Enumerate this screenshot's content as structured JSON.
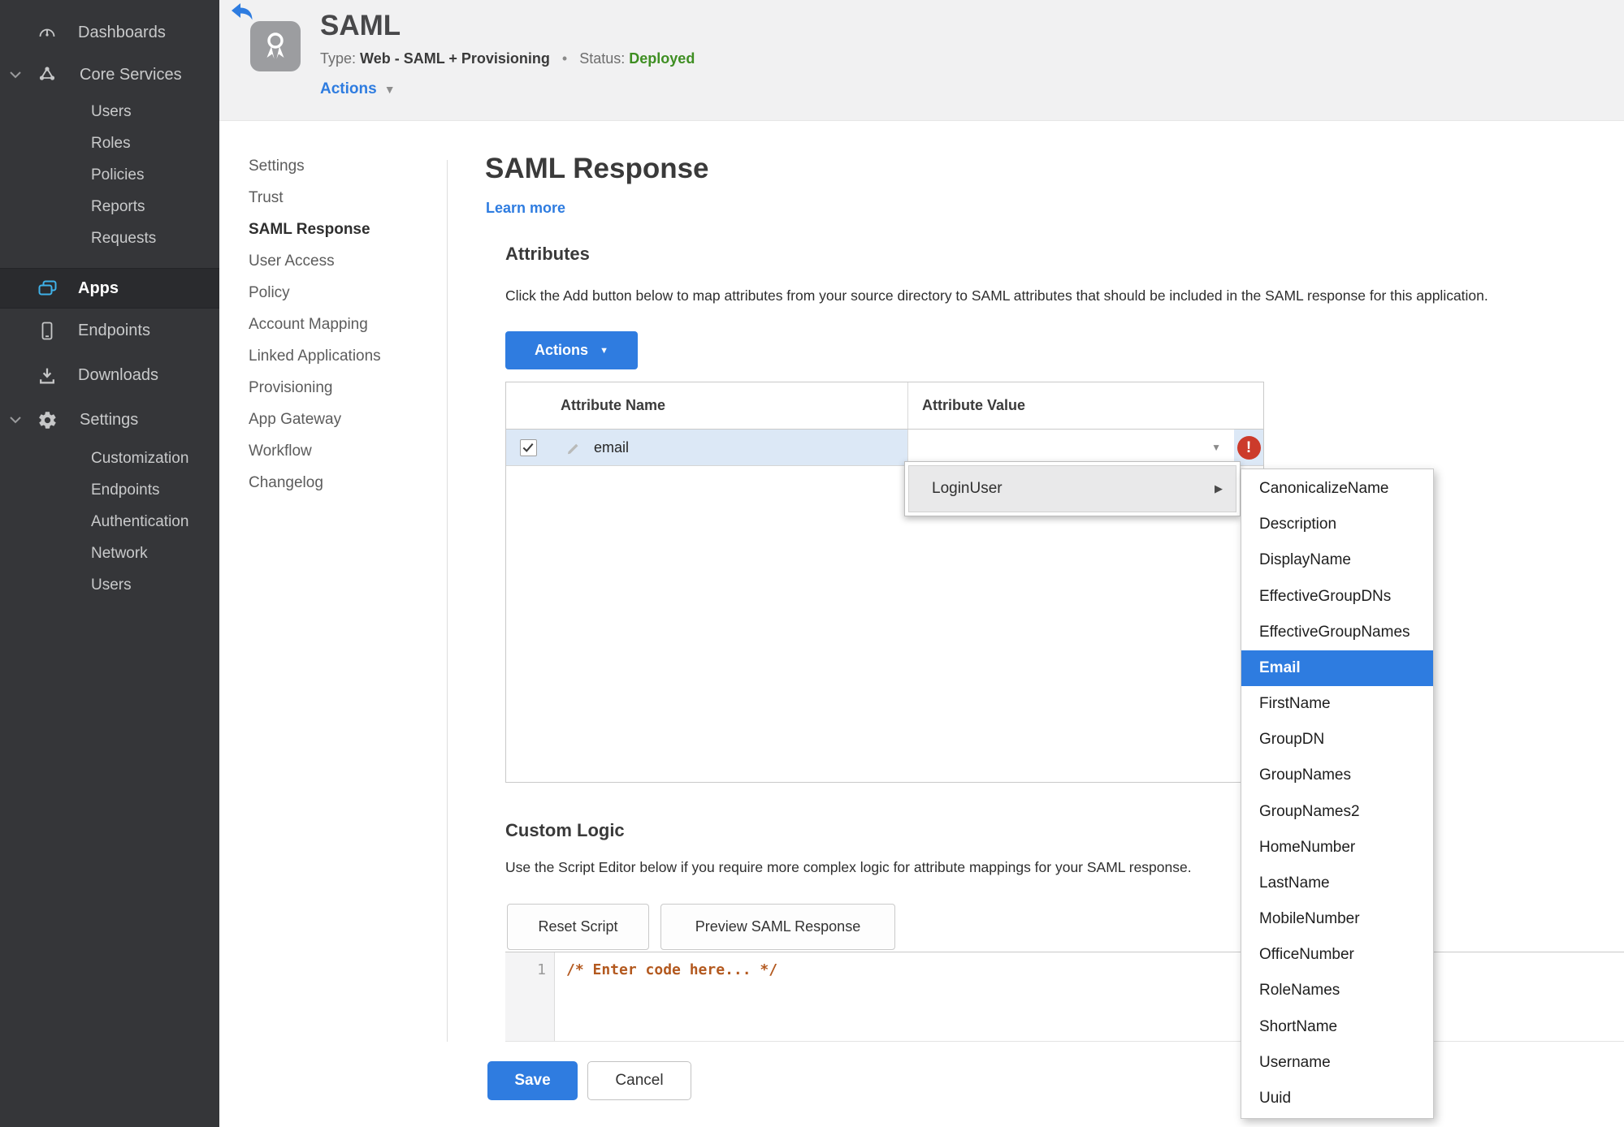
{
  "sidebar": {
    "dashboards": "Dashboards",
    "core_services": "Core Services",
    "core_sub": [
      "Users",
      "Roles",
      "Policies",
      "Reports",
      "Requests"
    ],
    "apps": "Apps",
    "endpoints": "Endpoints",
    "downloads": "Downloads",
    "settings": "Settings",
    "settings_sub": [
      "Customization",
      "Endpoints",
      "Authentication",
      "Network",
      "Users"
    ]
  },
  "header": {
    "title": "SAML",
    "type_label": "Type:",
    "type_value": "Web - SAML + Provisioning",
    "separator": "•",
    "status_label": "Status:",
    "status_value": "Deployed",
    "actions_label": "Actions"
  },
  "subnav": {
    "items": [
      "Settings",
      "Trust",
      "SAML Response",
      "User Access",
      "Policy",
      "Account Mapping",
      "Linked Applications",
      "Provisioning",
      "App Gateway",
      "Workflow",
      "Changelog"
    ],
    "active": "SAML Response"
  },
  "main": {
    "title": "SAML Response",
    "learn_more": "Learn more",
    "attributes": {
      "heading": "Attributes",
      "description": "Click the Add button below to map attributes from your source directory to SAML attributes that should be included in the SAML response for this application.",
      "actions_button": "Actions"
    },
    "table": {
      "col_name": "Attribute Name",
      "col_value": "Attribute Value",
      "row": {
        "checked": true,
        "name": "email",
        "value": ""
      }
    },
    "custom_logic": {
      "heading": "Custom Logic",
      "description": "Use the Script Editor below if you require more complex logic for attribute mappings for your SAML response.",
      "reset_button": "Reset Script",
      "preview_button": "Preview SAML Response"
    },
    "editor": {
      "line_number": "1",
      "code": "/* Enter code here... */"
    },
    "save_button": "Save",
    "cancel_button": "Cancel"
  },
  "dropdown": {
    "parent": "LoginUser",
    "selected": "Email",
    "items": [
      "CanonicalizeName",
      "Description",
      "DisplayName",
      "EffectiveGroupDNs",
      "EffectiveGroupNames",
      "Email",
      "FirstName",
      "GroupDN",
      "GroupNames",
      "GroupNames2",
      "HomeNumber",
      "LastName",
      "MobileNumber",
      "OfficeNumber",
      "RoleNames",
      "ShortName",
      "Username",
      "Uuid"
    ]
  },
  "icons": {
    "dropdown_caret": "▼",
    "submenu_arrow": "▶",
    "error_mark": "!"
  },
  "colors": {
    "accent_blue": "#2f7ce0",
    "status_green": "#3e8e22",
    "error_red": "#cc3b2b",
    "row_highlight": "#dce8f6",
    "sidebar_bg": "#353639"
  }
}
